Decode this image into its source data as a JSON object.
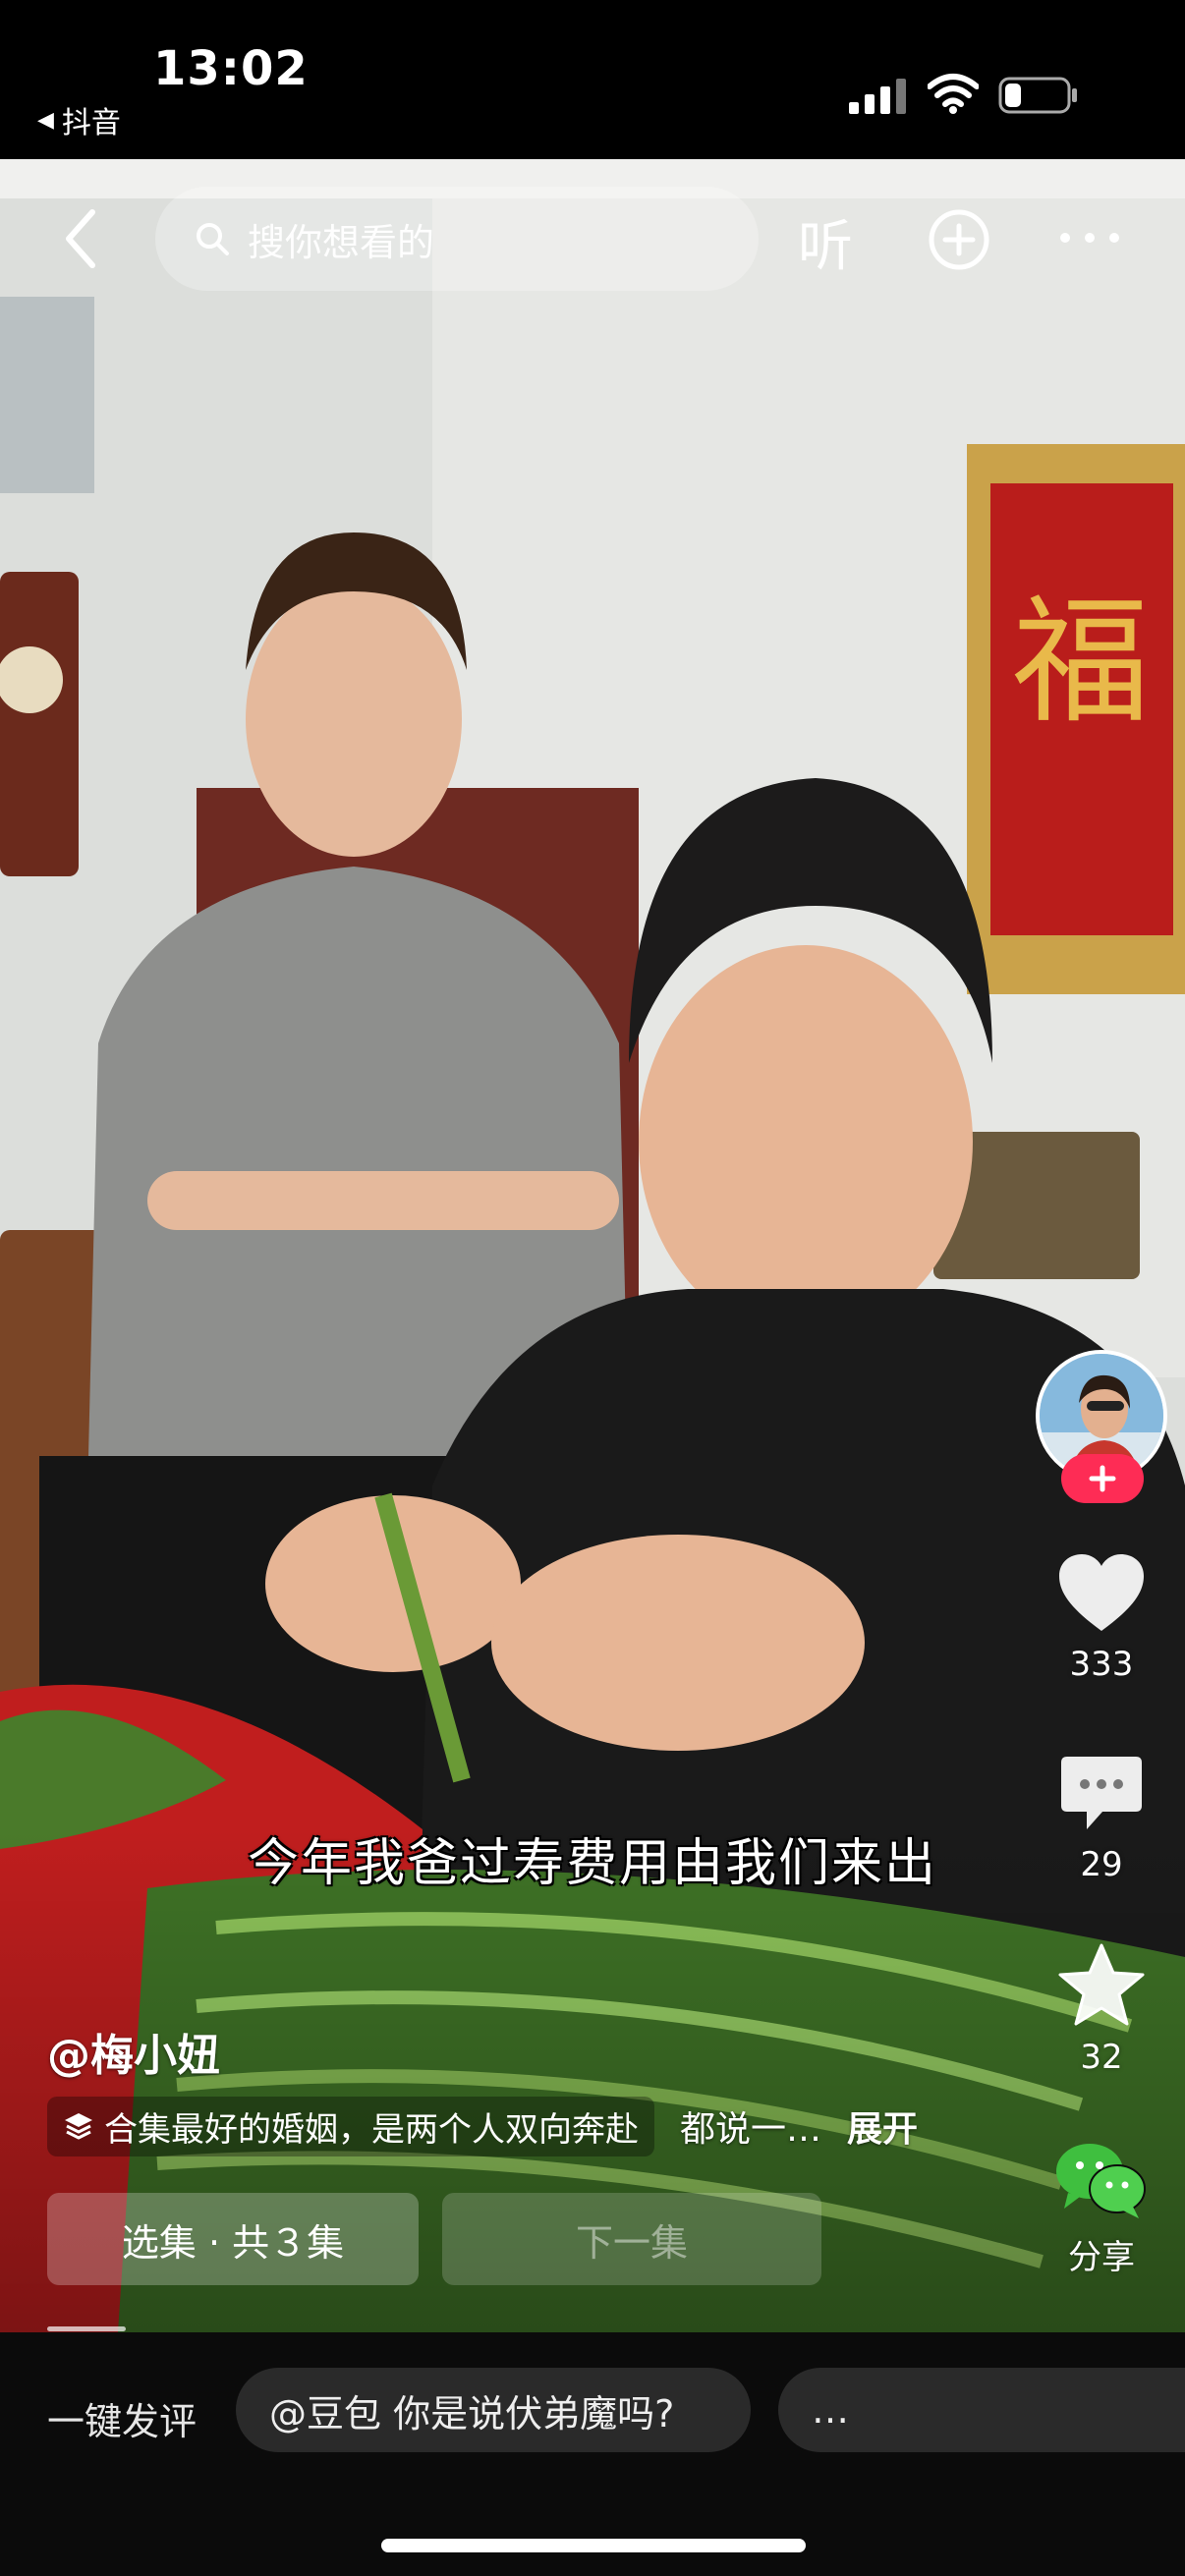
{
  "status_bar": {
    "time": "13:02",
    "back_app_label": "抖音",
    "icons": [
      "signal-icon",
      "wifi-icon",
      "battery-icon"
    ]
  },
  "top_nav": {
    "search_placeholder": "搜你想看的",
    "listen_label": "听"
  },
  "right_rail": {
    "likes": "333",
    "comments": "29",
    "favorites": "32",
    "share_label": "分享"
  },
  "video": {
    "subtitle": "今年我爸过寿费用由我们来出",
    "author": "@梅小妞",
    "collection_label": "合集最好的婚姻，是两个人双向奔赴",
    "description": "都说一…",
    "expand_label": "展开",
    "episodes_label": "选集 · 共３集",
    "next_label": "下一集"
  },
  "bottom": {
    "quick_comment_label": "一键发评",
    "chips": [
      "@豆包 你是说伏弟魔吗?",
      "…"
    ]
  },
  "colors": {
    "accent_red": "#fe2c55",
    "share_green": "#3fbf3f"
  }
}
